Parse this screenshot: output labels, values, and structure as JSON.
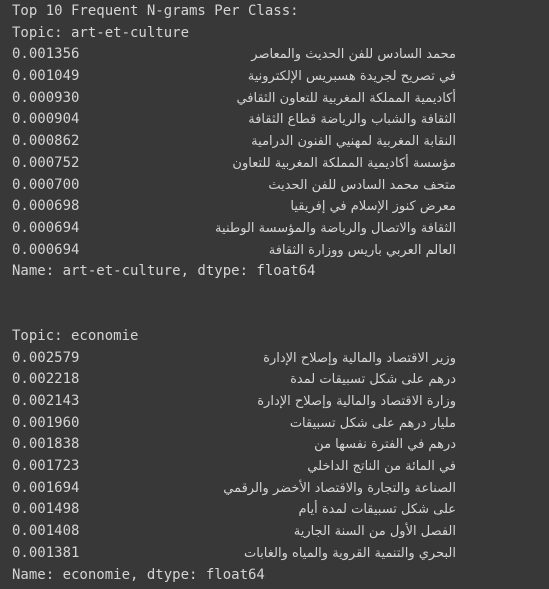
{
  "header": "Top 10 Frequent N-grams Per Class:",
  "blocks": [
    {
      "topic_line": "Topic: art-et-culture",
      "rows": [
        {
          "value": "0.001356",
          "gram": "محمد السادس للفن الحديث والمعاصر",
          "offset": -1
        },
        {
          "value": "0.001049",
          "gram": "في تصريح لجريدة هسبريس الإلكترونية",
          "offset": -2
        },
        {
          "value": "0.000930",
          "gram": "أكاديمية المملكة المغربية للتعاون الثقافي",
          "offset": 0
        },
        {
          "value": "0.000904",
          "gram": "الثقافة والشباب والرياضة قطاع الثقافة",
          "offset": 0
        },
        {
          "value": "0.000862",
          "gram": "النقابة المغربية لمهنيي الفنون الدرامية",
          "offset": -8
        },
        {
          "value": "0.000752",
          "gram": "مؤسسة أكاديمية المملكة المغربية للتعاون",
          "offset": -10
        },
        {
          "value": "0.000700",
          "gram": "متحف محمد السادس للفن الحديث",
          "offset": -1
        },
        {
          "value": "0.000698",
          "gram": "معرض كنوز الإسلام في إفريقيا",
          "offset": -2
        },
        {
          "value": "0.000694",
          "gram": "الثقافة والاتصال والرياضة والمؤسسة الوطنية",
          "offset": 0
        },
        {
          "value": "0.000694",
          "gram": "العالم العربي باريس ووزارة الثقافة",
          "offset": -18
        }
      ],
      "footer": "Name: art-et-culture, dtype: float64"
    },
    {
      "topic_line": "Topic: economie",
      "rows": [
        {
          "value": "0.002579",
          "gram": "وزير الاقتصاد والمالية وإصلاح الإدارة",
          "offset": -3
        },
        {
          "value": "0.002218",
          "gram": "درهم على شكل تسبيقات لمدة",
          "offset": -3
        },
        {
          "value": "0.002143",
          "gram": "وزارة الاقتصاد والمالية وإصلاح الإدارة",
          "offset": 7
        },
        {
          "value": "0.001960",
          "gram": "مليار درهم على شكل تسبيقات",
          "offset": 0
        },
        {
          "value": "0.001838",
          "gram": "درهم في الفترة نفسها من",
          "offset": -10
        },
        {
          "value": "0.001723",
          "gram": "في المائة من الناتج الداخلي",
          "offset": -4
        },
        {
          "value": "0.001694",
          "gram": "الصناعة والتجارة والاقتصاد الأخضر والرقمي",
          "offset": 1
        },
        {
          "value": "0.001498",
          "gram": "على شكل تسبيقات لمدة أيام",
          "offset": -5
        },
        {
          "value": "0.001408",
          "gram": "الفصل الأول من السنة الجارية",
          "offset": -3
        },
        {
          "value": "0.001381",
          "gram": "البحري والتنمية القروية والمياه والغابات",
          "offset": -12
        }
      ],
      "footer": "Name: economie, dtype: float64"
    }
  ]
}
